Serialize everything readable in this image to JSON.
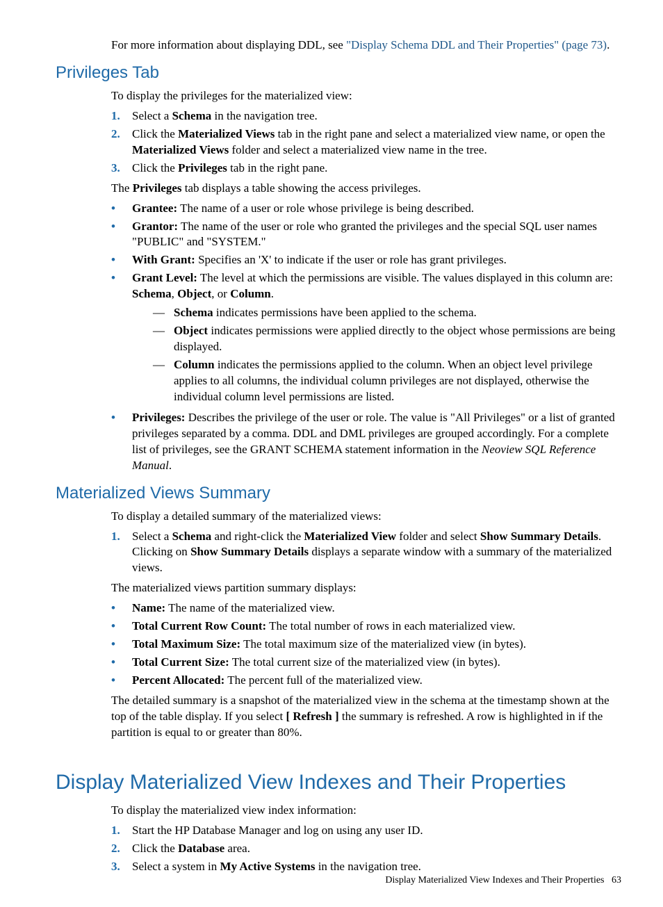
{
  "intro": {
    "ddl_more_info_prefix": "For more information about displaying DDL, see ",
    "ddl_more_info_link": "\"Display Schema DDL and Their Properties\" (page 73)",
    "ddl_more_info_suffix": "."
  },
  "privileges": {
    "title": "Privileges Tab",
    "lead": "To display the privileges for the materialized view:",
    "steps": [
      {
        "n": "1.",
        "pre": "Select a ",
        "bold1": "Schema",
        "rest": " in the navigation tree."
      },
      {
        "n": "2.",
        "pre": "Click the ",
        "bold1": "Materialized Views",
        "mid": " tab in the right pane and select a materialized view name, or open the ",
        "bold2": "Materialized Views",
        "rest": " folder and select a materialized view name in the tree."
      },
      {
        "n": "3.",
        "pre": "Click the ",
        "bold1": "Privileges",
        "rest": " tab in the right pane."
      }
    ],
    "after_steps_pre": "The ",
    "after_steps_bold": "Privileges",
    "after_steps_rest": " tab displays a table showing the access privileges.",
    "items": {
      "grantee": {
        "label": "Grantee:",
        "text": " The name of a user or role whose privilege is being described."
      },
      "grantor": {
        "label": "Grantor:",
        "text": " The name of the user or role who granted the privileges and the special SQL user names \"PUBLIC\" and \"SYSTEM.\""
      },
      "with_grant": {
        "label": "With Grant:",
        "text": " Specifies an 'X' to indicate if the user or role has grant privileges."
      },
      "grant_level": {
        "label": "Grant Level:",
        "text_pre": " The level at which the permissions are visible. The values displayed in this column are: ",
        "v1": "Schema",
        "c1": ", ",
        "v2": "Object",
        "c2": ", or ",
        "v3": "Column",
        "period": ".",
        "sub": [
          {
            "b": "Schema",
            "text": " indicates permissions have been applied to the schema."
          },
          {
            "b": "Object",
            "text": " indicates permissions were applied directly to the object whose permissions are being displayed."
          },
          {
            "b": "Column",
            "text": " indicates the permissions applied to the column. When an object level privilege applies to all columns, the individual column privileges are not displayed, otherwise the individual column level permissions are listed."
          }
        ]
      },
      "privileges_item": {
        "label": "Privileges:",
        "text_pre": " Describes the privilege of the user or role. The value is \"All Privileges\" or a list of granted privileges separated by a comma. DDL and DML privileges are grouped accordingly. For a complete list of privileges, see the GRANT SCHEMA statement information in the ",
        "ital": "Neoview SQL Reference Manual",
        "period": "."
      }
    }
  },
  "mvsummary": {
    "title": "Materialized Views Summary",
    "lead": "To display a detailed summary of the materialized views:",
    "step1": {
      "n": "1.",
      "pre": "Select a ",
      "b1": "Schema",
      "mid1": " and right-click the ",
      "b2": "Materialized View",
      "mid2": " folder and select ",
      "b3": "Show Summary Details",
      "mid3": ". Clicking on ",
      "b4": "Show Summary Details",
      "rest": " displays a separate window with a summary of the materialized views."
    },
    "after_step": "The materialized views partition summary displays:",
    "fields": {
      "name": {
        "label": "Name:",
        "text": " The name of the materialized view."
      },
      "tcrc": {
        "label": "Total Current Row Count:",
        "text": " The total number of rows in each materialized view."
      },
      "tms": {
        "label": "Total Maximum Size:",
        "text": " The total maximum size of the materialized view (in bytes)."
      },
      "tcs": {
        "label": "Total Current Size:",
        "text": " The total current size of the materialized view (in bytes)."
      },
      "pa": {
        "label": "Percent Allocated:",
        "text": " The percent full of the materialized view."
      }
    },
    "trailer_pre": "The detailed summary is a snapshot of the materialized view in the schema at the timestamp shown at the top of the table display. If you select ",
    "trailer_bold": "[ Refresh ]",
    "trailer_rest": " the summary is refreshed. A row is highlighted in if the partition is equal to or greater than 80%."
  },
  "mvindexes": {
    "title": "Display Materialized View Indexes and Their Properties",
    "lead": "To display the materialized view index information:",
    "steps": [
      {
        "n": "1.",
        "text": "Start the HP Database Manager and log on using any user ID."
      },
      {
        "n": "2.",
        "pre": "Click the ",
        "b": "Database",
        "rest": " area."
      },
      {
        "n": "3.",
        "pre": "Select a system in ",
        "b": "My Active Systems",
        "rest": " in the navigation tree."
      }
    ]
  },
  "footer": {
    "text": "Display Materialized View Indexes and Their Properties",
    "page": "63"
  }
}
